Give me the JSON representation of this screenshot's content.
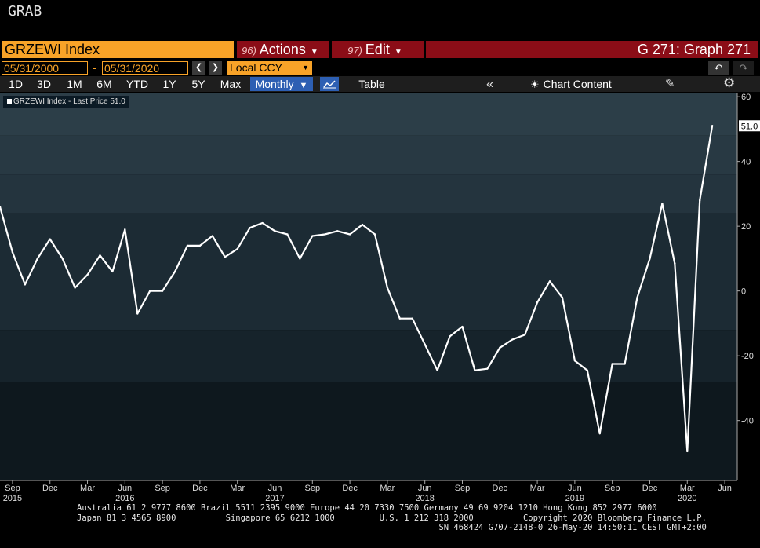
{
  "app": {
    "grab_label": "GRAB"
  },
  "command_bar": {
    "ticker": "GRZEWI Index",
    "actions_num": "96)",
    "actions_label": "Actions",
    "edit_num": "97)",
    "edit_label": "Edit",
    "graph_title": "G 271: Graph 271"
  },
  "date_row": {
    "start_date": "05/31/2000",
    "separator": "-",
    "end_date": "05/31/2020",
    "currency": "Local CCY",
    "prev_icon": "chevron-left-icon",
    "next_icon": "chevron-right-icon"
  },
  "period_toolbar": {
    "periods": [
      "1D",
      "3D",
      "1M",
      "6M",
      "YTD",
      "1Y",
      "5Y",
      "Max"
    ],
    "frequency": "Monthly",
    "table_label": "Table",
    "chart_content_label": "Chart Content"
  },
  "legend": {
    "text": "GRZEWI Index - Last Price 51.0"
  },
  "colors": {
    "background": "#000000",
    "plot_background": "#1d2a33",
    "accent_orange": "#f8a328",
    "header_red": "#8b0d17",
    "active_blue": "#2d5fb3",
    "series_line": "#ffffff"
  },
  "chart_data": {
    "type": "line",
    "series": [
      {
        "name": "GRZEWI Index - Last Price",
        "last_value_label": "51.0",
        "x": [
          "2015-08",
          "2015-09",
          "2015-10",
          "2015-11",
          "2015-12",
          "2016-01",
          "2016-02",
          "2016-03",
          "2016-04",
          "2016-05",
          "2016-06",
          "2016-07",
          "2016-08",
          "2016-09",
          "2016-10",
          "2016-11",
          "2016-12",
          "2017-01",
          "2017-02",
          "2017-03",
          "2017-04",
          "2017-05",
          "2017-06",
          "2017-07",
          "2017-08",
          "2017-09",
          "2017-10",
          "2017-11",
          "2017-12",
          "2018-01",
          "2018-02",
          "2018-03",
          "2018-04",
          "2018-05",
          "2018-06",
          "2018-07",
          "2018-08",
          "2018-09",
          "2018-10",
          "2018-11",
          "2018-12",
          "2019-01",
          "2019-02",
          "2019-03",
          "2019-04",
          "2019-05",
          "2019-06",
          "2019-07",
          "2019-08",
          "2019-09",
          "2019-10",
          "2019-11",
          "2019-12",
          "2020-01",
          "2020-02",
          "2020-03",
          "2020-04",
          "2020-05"
        ],
        "values": [
          26,
          12,
          2,
          10,
          16,
          10,
          1,
          5,
          11,
          6,
          19,
          -7,
          0,
          0,
          6,
          14,
          14,
          17,
          10.5,
          13,
          19.5,
          21,
          18.5,
          17.5,
          10,
          17,
          17.5,
          18.5,
          17.5,
          20.5,
          17.5,
          1,
          -8.5,
          -8.5,
          -16.5,
          -24.5,
          -14,
          -11,
          -24.5,
          -24,
          -17.5,
          -15,
          -13.5,
          -3.5,
          3,
          -2,
          -21.5,
          -24.5,
          -44,
          -22.5,
          -22.5,
          -2,
          10,
          27,
          8.5,
          -49.5,
          28,
          51
        ]
      }
    ],
    "x_ticks": [
      {
        "month": "Sep",
        "year": "2015",
        "x": "2015-09"
      },
      {
        "month": "Dec",
        "year": "",
        "x": "2015-12"
      },
      {
        "month": "Mar",
        "year": "",
        "x": "2016-03"
      },
      {
        "month": "Jun",
        "year": "2016",
        "x": "2016-06"
      },
      {
        "month": "Sep",
        "year": "",
        "x": "2016-09"
      },
      {
        "month": "Dec",
        "year": "",
        "x": "2016-12"
      },
      {
        "month": "Mar",
        "year": "",
        "x": "2017-03"
      },
      {
        "month": "Jun",
        "year": "2017",
        "x": "2017-06"
      },
      {
        "month": "Sep",
        "year": "",
        "x": "2017-09"
      },
      {
        "month": "Dec",
        "year": "",
        "x": "2017-12"
      },
      {
        "month": "Mar",
        "year": "",
        "x": "2018-03"
      },
      {
        "month": "Jun",
        "year": "2018",
        "x": "2018-06"
      },
      {
        "month": "Sep",
        "year": "",
        "x": "2018-09"
      },
      {
        "month": "Dec",
        "year": "",
        "x": "2018-12"
      },
      {
        "month": "Mar",
        "year": "",
        "x": "2019-03"
      },
      {
        "month": "Jun",
        "year": "2019",
        "x": "2019-06"
      },
      {
        "month": "Sep",
        "year": "",
        "x": "2019-09"
      },
      {
        "month": "Dec",
        "year": "",
        "x": "2019-12"
      },
      {
        "month": "Mar",
        "year": "2020",
        "x": "2020-03"
      },
      {
        "month": "Jun",
        "year": "",
        "x": "2020-06"
      }
    ],
    "y_ticks": [
      60,
      40,
      20,
      0,
      -20,
      -40
    ],
    "ylim": [
      -58.5,
      61
    ],
    "xlim": [
      "2015-08",
      "2020-07"
    ],
    "title": "",
    "xlabel": "",
    "ylabel": "",
    "axis_side": "right",
    "legend_position": "top-left"
  },
  "footer": {
    "line1": "Australia 61 2 9777 8600 Brazil 5511 2395 9000 Europe 44 20 7330 7500 Germany 49 69 9204 1210 Hong Kong 852 2977 6000",
    "line2": "Japan 81 3 4565 8900          Singapore 65 6212 1000         U.S. 1 212 318 2000          Copyright 2020 Bloomberg Finance L.P.",
    "line3": "                                                                         SN 468424 G707-2148-0 26-May-20 14:50:11 CEST GMT+2:00"
  }
}
